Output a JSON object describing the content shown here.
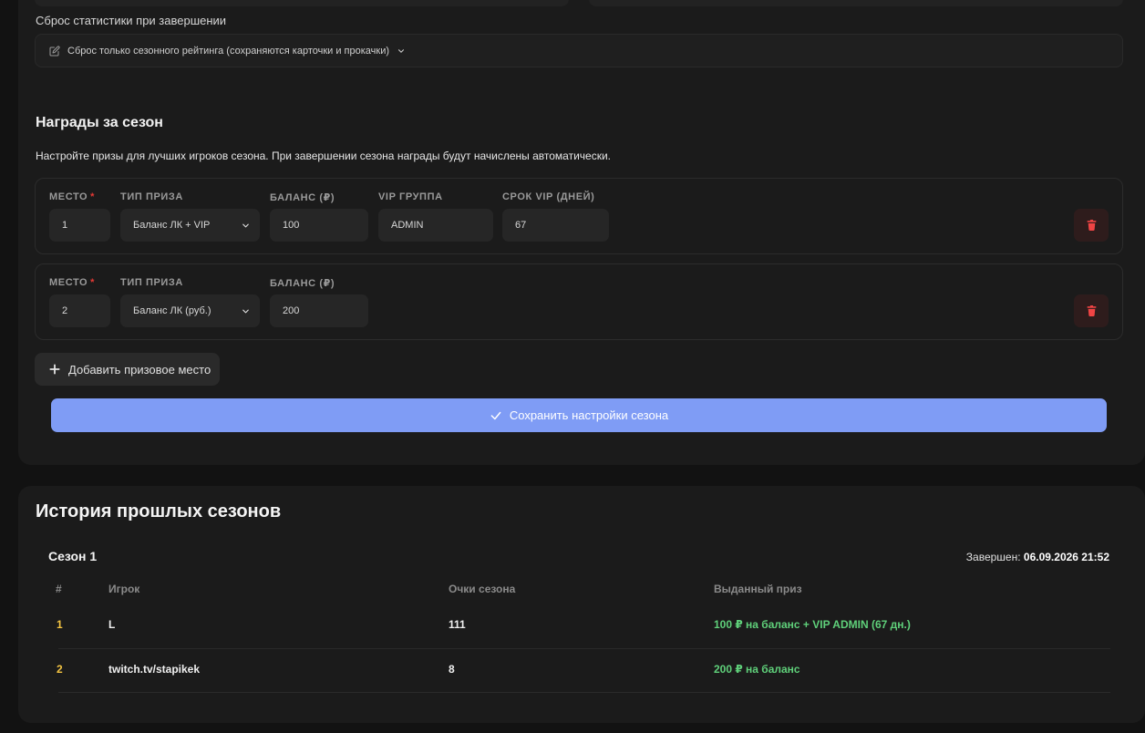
{
  "stats_reset": {
    "label": "Сброс статистики при завершении",
    "selected": "Сброс только сезонного рейтинга (сохраняются карточки и прокачки)"
  },
  "rewards": {
    "title": "Награды за сезон",
    "description": "Настройте призы для лучших игроков сезона. При завершении сезона награды будут начислены автоматически.",
    "field_labels": {
      "place": "МЕСТО",
      "prize_type": "ТИП ПРИЗА",
      "balance": "БАЛАНС (₽)",
      "vip_group": "VIP ГРУППА",
      "vip_days": "СРОК VIP (ДНЕЙ)"
    },
    "required_mark": "*",
    "prizes": [
      {
        "place": "1",
        "prize_type": "Баланс ЛК + VIP",
        "balance": "100",
        "vip_group": "ADMIN",
        "vip_days": "67"
      },
      {
        "place": "2",
        "prize_type": "Баланс ЛК (руб.)",
        "balance": "200"
      }
    ],
    "add_button": "Добавить призовое место",
    "save_button": "Сохранить настройки сезона"
  },
  "history": {
    "title": "История прошлых сезонов",
    "season_name": "Сезон 1",
    "finished_label": "Завершен:",
    "finished_date": "06.09.2026 21:52",
    "columns": [
      "#",
      "Игрок",
      "Очки сезона",
      "Выданный приз"
    ],
    "rows": [
      {
        "rank": "1",
        "player": "L",
        "points": "111",
        "prize": "100 ₽ на баланс + VIP ADMIN (67 дн.)"
      },
      {
        "rank": "2",
        "player": "twitch.tv/stapikek",
        "points": "8",
        "prize": "200 ₽ на баланс"
      }
    ]
  },
  "colors": {
    "accent": "#7f9cf5",
    "danger": "#e53935",
    "rank": "#f5c542",
    "prize": "#5fd07a"
  }
}
